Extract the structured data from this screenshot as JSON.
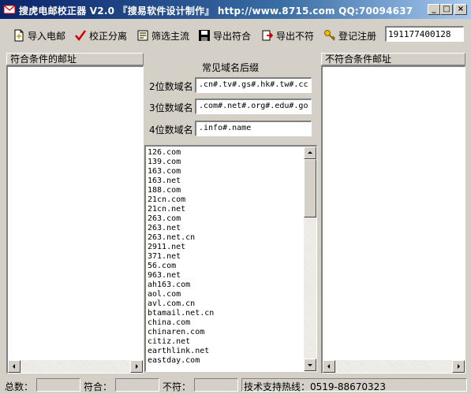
{
  "window": {
    "title": "搜虎电邮校正器 V2.0  『搜易软件设计制作』  http://www.8715.com  QQ:70094637",
    "minimize_label": "_",
    "maximize_label": "□",
    "close_label": "×"
  },
  "toolbar": {
    "buttons": [
      {
        "label": "导入电邮",
        "icon": "import-icon"
      },
      {
        "label": "校正分离",
        "icon": "checkmark-icon"
      },
      {
        "label": "筛选主流",
        "icon": "filter-icon"
      },
      {
        "label": "导出符合",
        "icon": "floppy-disk-icon"
      },
      {
        "label": "导出不符",
        "icon": "export-icon"
      },
      {
        "label": "登记注册",
        "icon": "key-icon"
      }
    ],
    "registration_code": "191177400128"
  },
  "left_panel": {
    "header": "符合条件的邮址"
  },
  "right_panel": {
    "header": "不符合条件邮址"
  },
  "domain_group": {
    "title": "常见域名后缀",
    "rows": [
      {
        "label": "2位数域名",
        "value": ".cn#.tv#.gs#.hk#.tw#.cc"
      },
      {
        "label": "3位数域名",
        "value": ".com#.net#.org#.edu#.go"
      },
      {
        "label": "4位数域名",
        "value": ".info#.name"
      }
    ]
  },
  "domain_list": [
    "126.com",
    "139.com",
    "163.com",
    "163.net",
    "188.com",
    "21cn.com",
    "21cn.net",
    "263.com",
    "263.net",
    "263.net.cn",
    "2911.net",
    "371.net",
    "56.com",
    "963.net",
    "ah163.com",
    "aol.com",
    "avl.com.cn",
    "btamail.net.cn",
    "china.com",
    "chinaren.com",
    "citiz.net",
    "earthlink.net",
    "eastday.com"
  ],
  "statusbar": {
    "total_label": "总数：",
    "match_label": "符合：",
    "mismatch_label": "不符：",
    "support_text": "技术支持热线：0519-88670323"
  },
  "colors": {
    "titlebar_start": "#0a246a",
    "titlebar_end": "#a6caf0",
    "face": "#d4d0c8"
  }
}
